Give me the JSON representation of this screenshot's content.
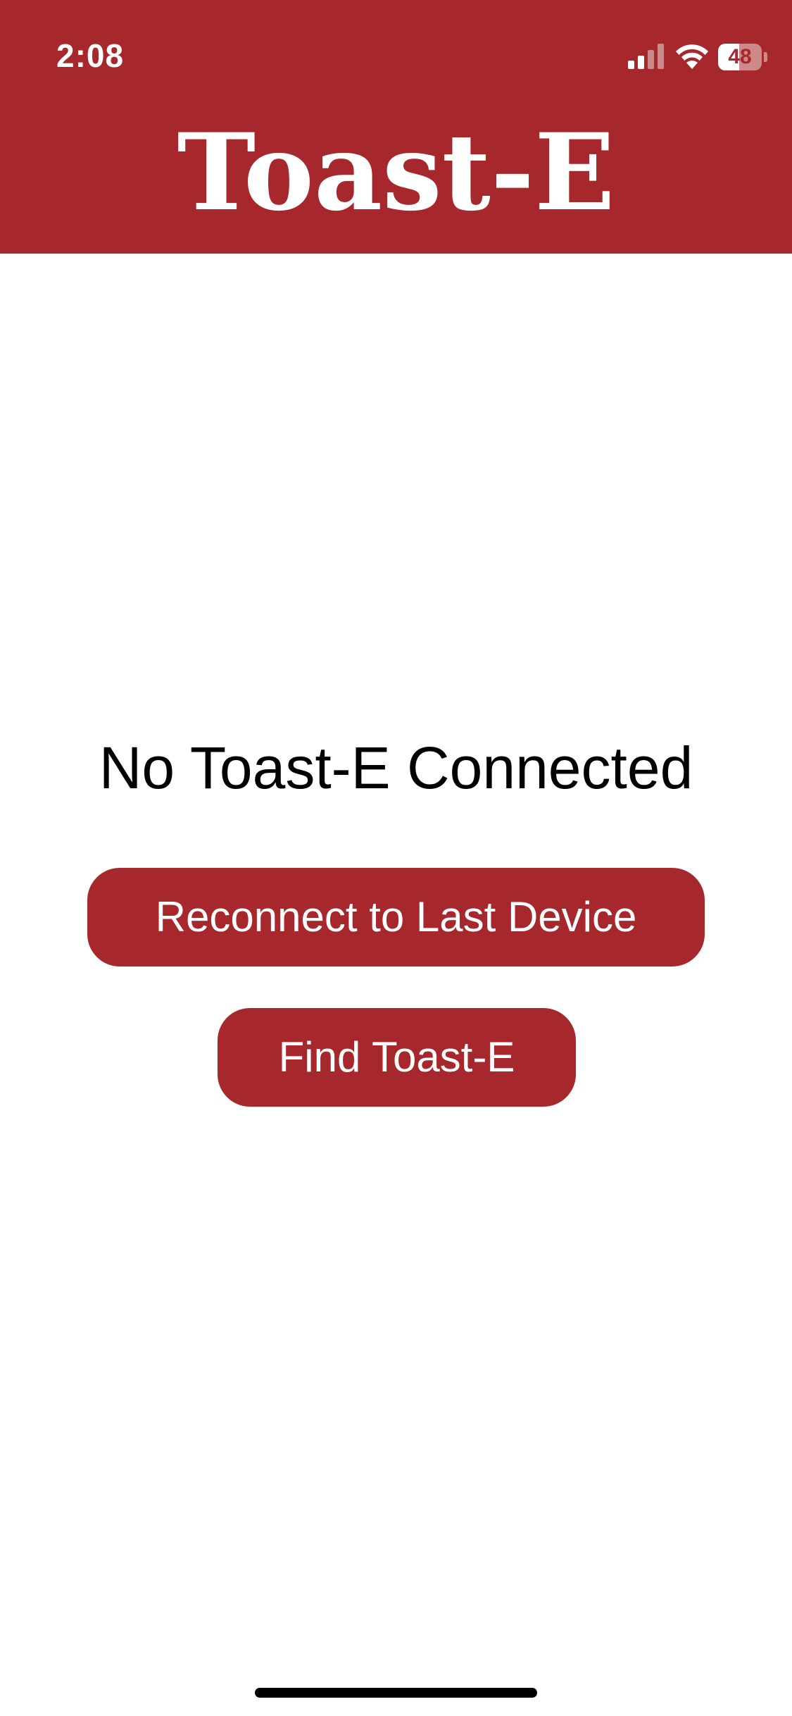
{
  "status_bar": {
    "time": "2:08",
    "battery_level": "48",
    "battery_fraction": 0.48,
    "signal_icon": "cellular-signal-icon",
    "wifi_icon": "wifi-icon"
  },
  "header": {
    "title": "Toast-E"
  },
  "main": {
    "status_text": "No Toast-E Connected",
    "reconnect_label": "Reconnect to Last Device",
    "find_label": "Find Toast-E"
  },
  "colors": {
    "brand": "#a6282c",
    "background": "#ffffff",
    "text": "#000000"
  }
}
